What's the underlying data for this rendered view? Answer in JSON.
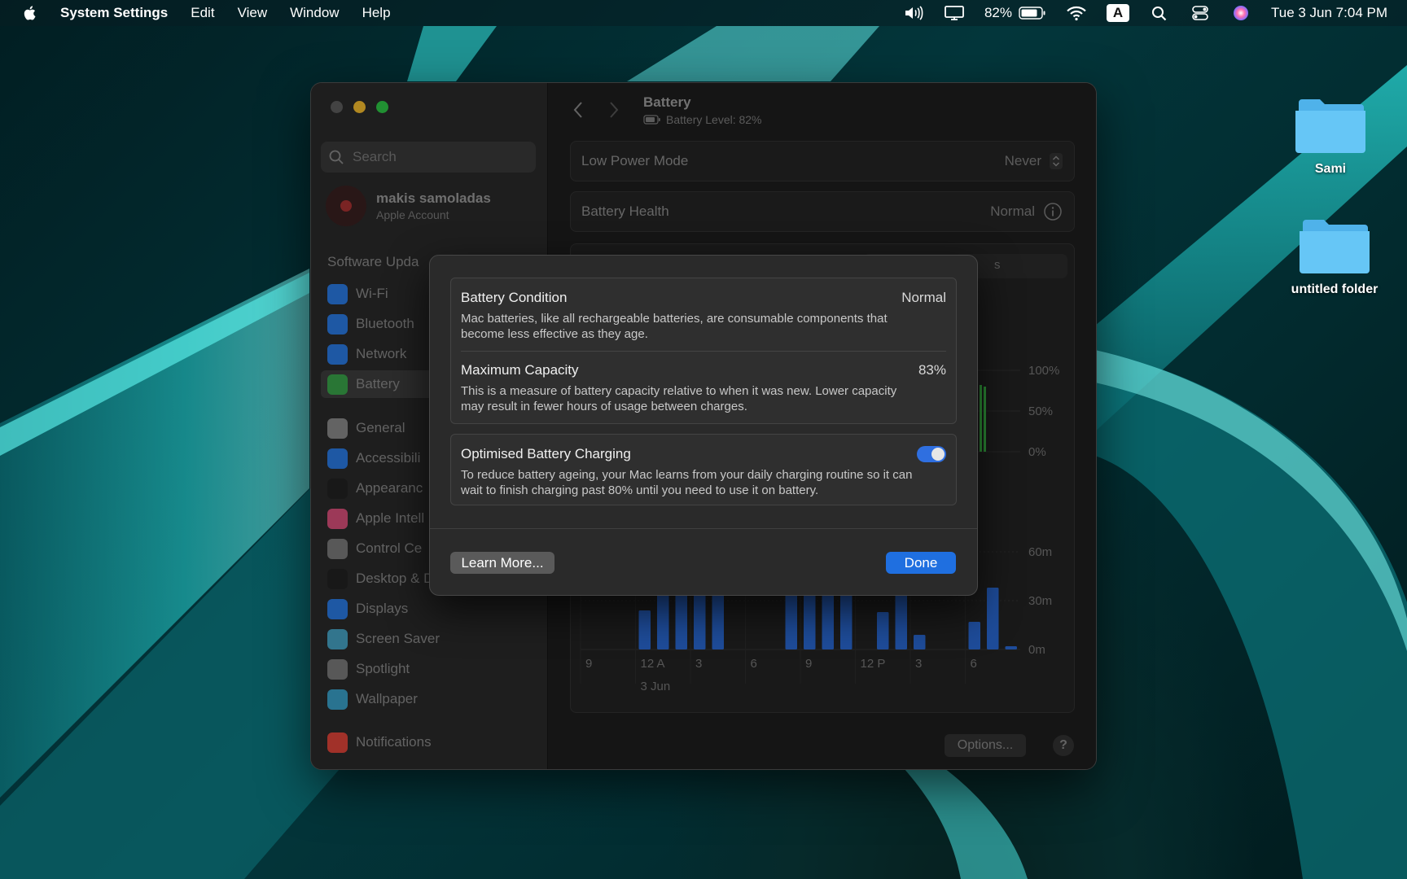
{
  "menubar": {
    "app_name": "System Settings",
    "menus": [
      "Edit",
      "View",
      "Window",
      "Help"
    ],
    "battery_percent": "82%",
    "input_source": "A",
    "datetime": "Tue 3 Jun  7:04 PM"
  },
  "desktop": {
    "icons": [
      {
        "label": "Sami"
      },
      {
        "label": "untitled folder"
      }
    ]
  },
  "sidebar": {
    "search_placeholder": "Search",
    "account_name": "makis samoladas",
    "account_sub": "Apple Account",
    "software_update": "Software Upda",
    "items": [
      {
        "label": "Wi-Fi",
        "color": "#2a7be4"
      },
      {
        "label": "Bluetooth",
        "color": "#2a7be4"
      },
      {
        "label": "Network",
        "color": "#2a7be4"
      },
      {
        "label": "Battery",
        "color": "#3aa44a"
      },
      {
        "label": "General",
        "color": "#8a8a8a"
      },
      {
        "label": "Accessibili",
        "color": "#2a7be4"
      },
      {
        "label": "Appearanc",
        "color": "#222222"
      },
      {
        "label": "Apple Intell",
        "color": "#d9507a"
      },
      {
        "label": "Control Ce",
        "color": "#7a7a7a"
      },
      {
        "label": "Desktop & Dock",
        "color": "#222222"
      },
      {
        "label": "Displays",
        "color": "#2a7be4"
      },
      {
        "label": "Screen Saver",
        "color": "#46a3c4"
      },
      {
        "label": "Spotlight",
        "color": "#7a7a7a"
      },
      {
        "label": "Wallpaper",
        "color": "#3aa0c8"
      },
      {
        "label": "Notifications",
        "color": "#e0443a"
      }
    ]
  },
  "main": {
    "title": "Battery",
    "subtitle": "Battery Level: 82%",
    "low_power_label": "Low Power Mode",
    "low_power_value": "Never",
    "health_label": "Battery Health",
    "health_value": "Normal",
    "segment_partial": "s",
    "options_label": "Options...",
    "help_label": "?"
  },
  "chart_data": [
    {
      "type": "bar",
      "title": "",
      "y_tick_labels": [
        "100%",
        "50%",
        "0%"
      ],
      "ylim": [
        0,
        100
      ]
    },
    {
      "type": "bar",
      "title": "",
      "categories": [
        "9",
        "12 A",
        "3",
        "6",
        "9",
        "12 P",
        "3",
        "6"
      ],
      "date_label": "3 Jun",
      "y_tick_labels": [
        "60m",
        "30m",
        "0m"
      ],
      "ylim": [
        0,
        60
      ],
      "values_minutes": [
        0,
        0,
        0,
        24,
        60,
        60,
        60,
        60,
        0,
        0,
        0,
        60,
        60,
        60,
        60,
        0,
        23,
        60,
        9,
        0,
        0,
        17,
        38,
        2
      ]
    }
  ],
  "sheet": {
    "condition_title": "Battery Condition",
    "condition_value": "Normal",
    "condition_desc": "Mac batteries, like all rechargeable batteries, are consumable components that become less effective as they age.",
    "capacity_title": "Maximum Capacity",
    "capacity_value": "83%",
    "capacity_desc": "This is a measure of battery capacity relative to when it was new. Lower capacity may result in fewer hours of usage between charges.",
    "optimised_title": "Optimised Battery Charging",
    "optimised_desc": "To reduce battery ageing, your Mac learns from your daily charging routine so it can wait to finish charging past 80% until you need to use it on battery.",
    "optimised_enabled": true,
    "learn_more": "Learn More...",
    "done": "Done"
  },
  "colors": {
    "accent": "#1f6fe0",
    "bar_blue": "#2a6ad6",
    "bar_green": "#3cc048"
  }
}
